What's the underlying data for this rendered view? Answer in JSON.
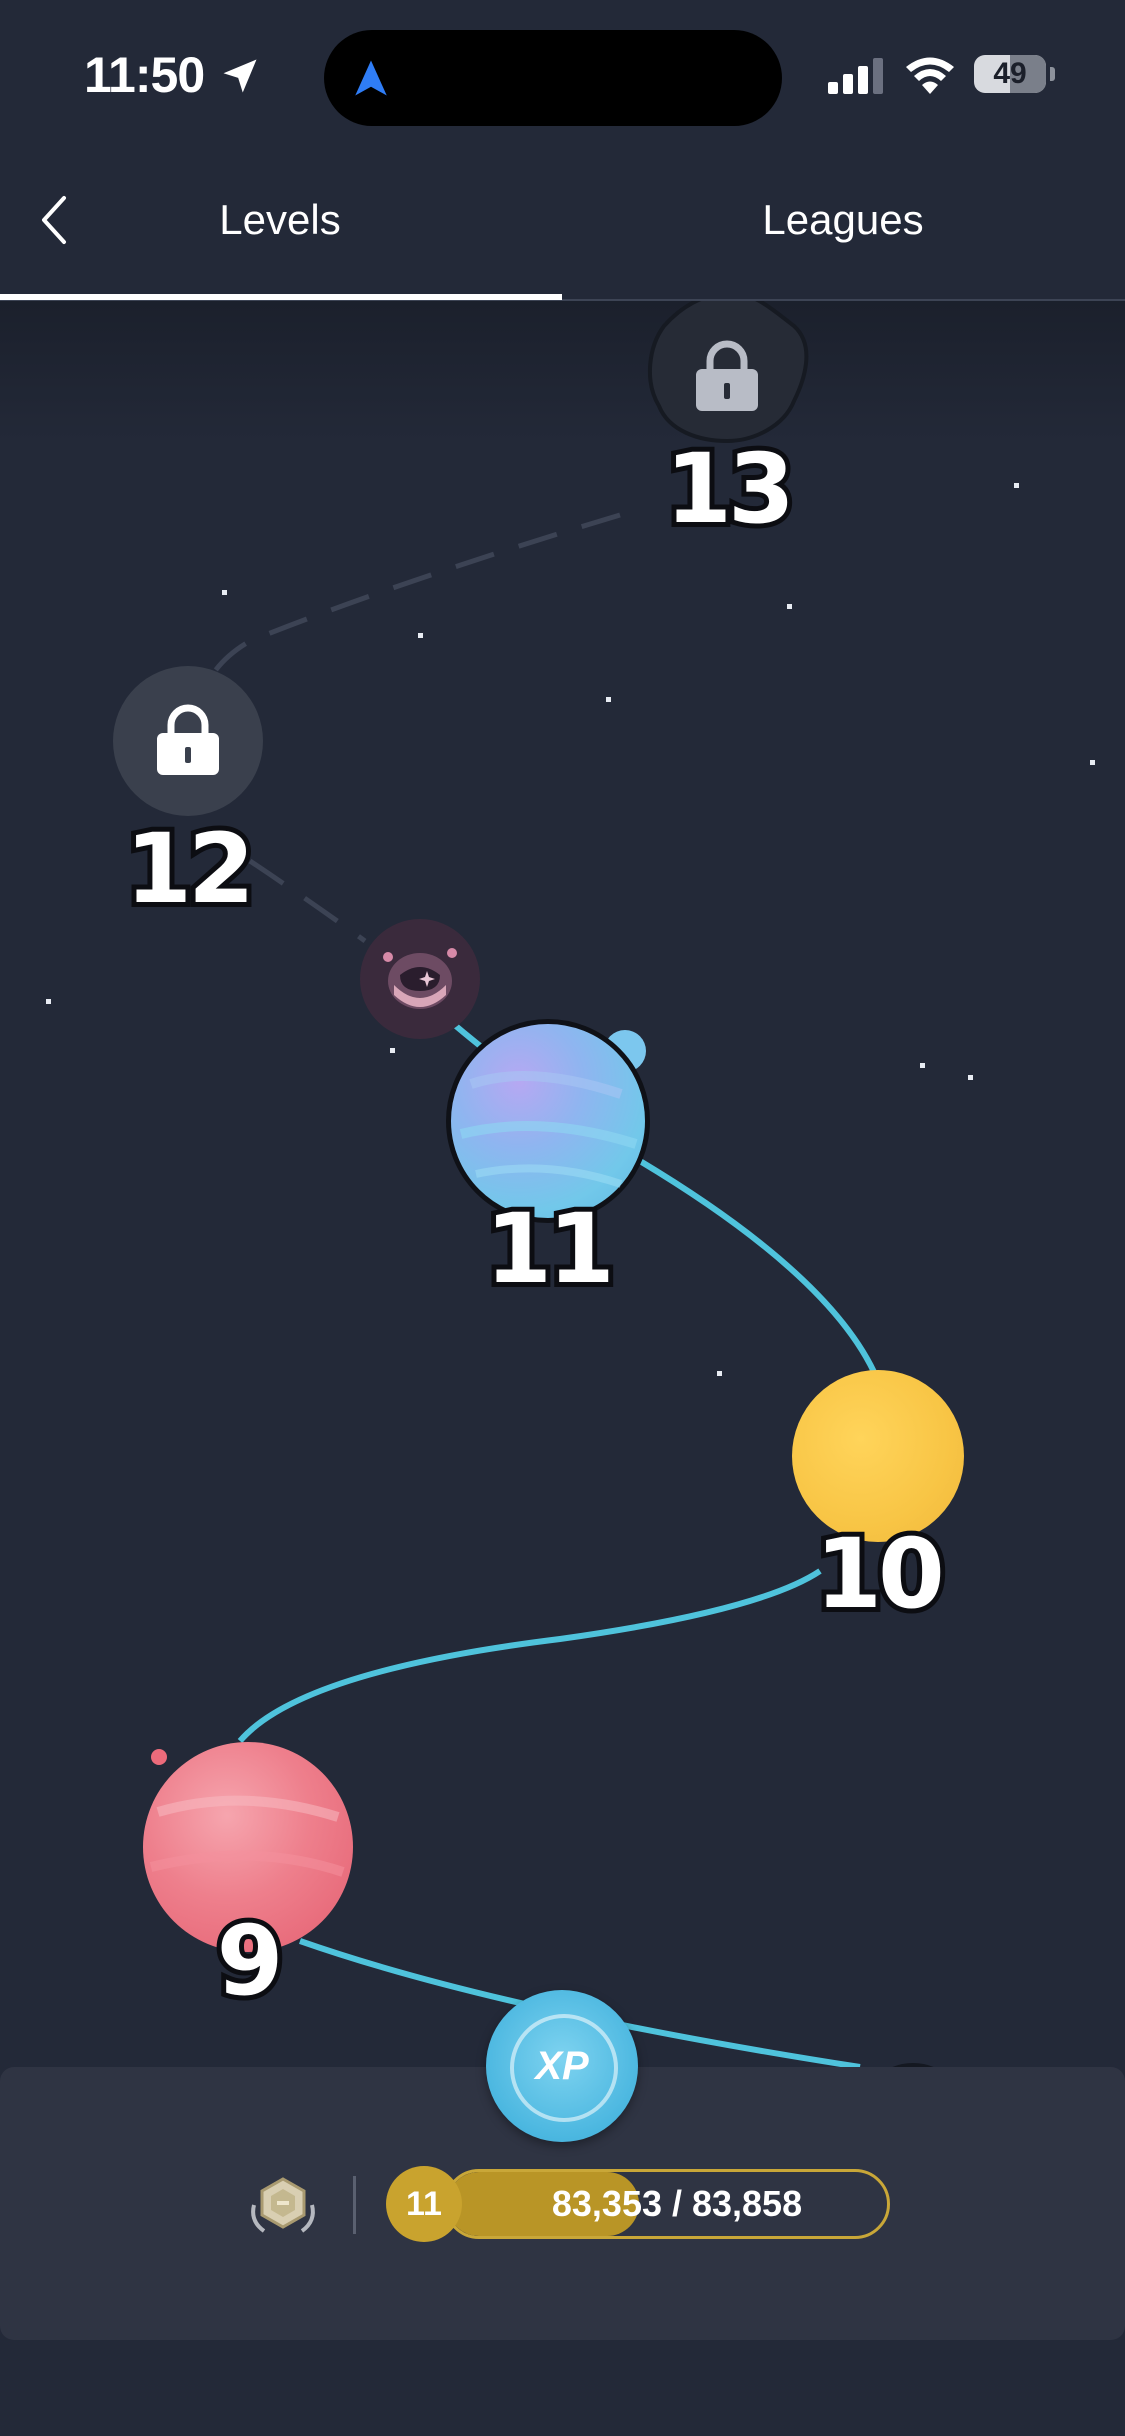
{
  "status_bar": {
    "time": "11:50",
    "battery": "49"
  },
  "tabs": [
    {
      "label": "Levels",
      "active": true
    },
    {
      "label": "Leagues",
      "active": false
    }
  ],
  "levels": [
    {
      "number": "13",
      "state": "locked"
    },
    {
      "number": "12",
      "state": "locked"
    },
    {
      "number": "11",
      "state": "current",
      "color": "#7fb8ef"
    },
    {
      "number": "10",
      "state": "completed",
      "color": "#f8c545"
    },
    {
      "number": "9",
      "state": "completed",
      "color": "#ec6b7b"
    }
  ],
  "progress": {
    "level": "11",
    "text": "83,353 / 83,858",
    "fraction": 0.994
  },
  "xp_badge": "XP",
  "colors": {
    "path": "#4fc3dc",
    "background": "#232938",
    "gold": "#c9a32e"
  }
}
